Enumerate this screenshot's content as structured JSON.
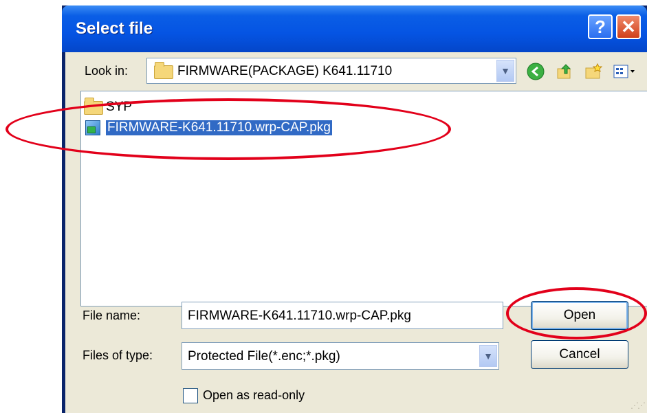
{
  "window": {
    "title": "Select file"
  },
  "toolbar": {
    "look_in_label": "Look in:",
    "look_in_value": "FIRMWARE(PACKAGE) K641.11710"
  },
  "files": [
    {
      "name": "SYP",
      "type": "folder",
      "selected": false
    },
    {
      "name": "FIRMWARE-K641.11710.wrp-CAP.pkg",
      "type": "package",
      "selected": true
    }
  ],
  "form": {
    "file_name_label": "File name:",
    "file_name_value": "FIRMWARE-K641.11710.wrp-CAP.pkg",
    "file_type_label": "Files of type:",
    "file_type_value": "Protected File(*.enc;*.pkg)",
    "readonly_label": "Open as read-only",
    "readonly_checked": false
  },
  "buttons": {
    "open": "Open",
    "cancel": "Cancel"
  },
  "colors": {
    "titlebar": "#0554e3",
    "selection": "#316ac5",
    "annotation": "#e2001a"
  }
}
